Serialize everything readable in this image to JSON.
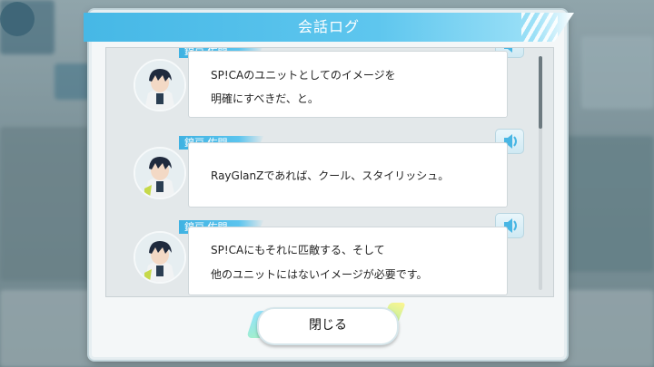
{
  "dialog": {
    "title": "会話ログ",
    "close_label": "閉じる"
  },
  "log": [
    {
      "speaker": "錦戸 佐門",
      "lines": [
        "SP!CAのユニットとしてのイメージを",
        "明確にすべきだ、と。"
      ],
      "voice_icon": "speaker-icon"
    },
    {
      "speaker": "錦戸 佐門",
      "lines": [
        "RayGlanZであれば、クール、スタイリッシュ。"
      ],
      "voice_icon": "speaker-icon"
    },
    {
      "speaker": "錦戸 佐門",
      "lines": [
        "SP!CAにもそれに匹敵する、そして",
        "他のユニットにはないイメージが必要です。"
      ],
      "voice_icon": "speaker-icon"
    }
  ],
  "colors": {
    "accent": "#46b8e6",
    "nametag": "#3fb2e2"
  }
}
